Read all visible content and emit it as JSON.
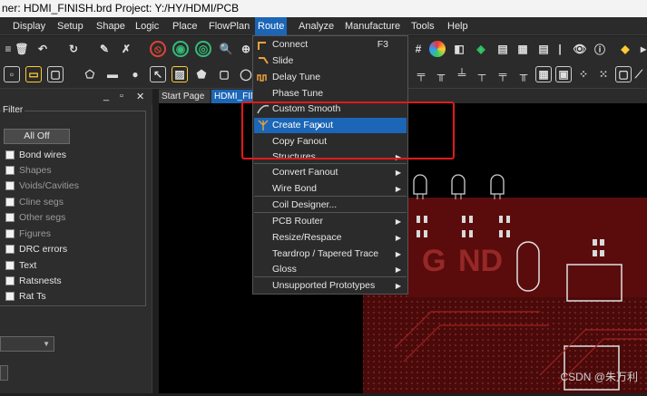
{
  "window": {
    "title": "ner: HDMI_FINISH.brd  Project: Y:/HY/HDMI/PCB"
  },
  "menubar": {
    "items": [
      "Display",
      "Setup",
      "Shape",
      "Logic",
      "Place",
      "FlowPlan",
      "Route",
      "Analyze",
      "Manufacture",
      "Tools",
      "Help"
    ],
    "active": "Route"
  },
  "route_menu": {
    "items": [
      {
        "label": "Connect",
        "shortcut": "F3",
        "submenu": false
      },
      {
        "label": "Slide",
        "submenu": false
      },
      {
        "label": "Delay Tune",
        "submenu": false
      },
      {
        "label": "Phase Tune",
        "submenu": false
      },
      {
        "label": "Custom Smooth",
        "submenu": false
      },
      {
        "label": "Create Fanout",
        "submenu": false,
        "highlighted": true
      },
      {
        "label": "Copy Fanout",
        "submenu": false
      },
      {
        "label": "Structures",
        "submenu": true
      },
      {
        "label": "Convert Fanout",
        "submenu": true
      },
      {
        "label": "Wire Bond",
        "submenu": true
      },
      {
        "label": "Coil Designer...",
        "submenu": false
      },
      {
        "label": "PCB Router",
        "submenu": true
      },
      {
        "label": "Resize/Respace",
        "submenu": true
      },
      {
        "label": "Teardrop / Tapered Trace",
        "submenu": true
      },
      {
        "label": "Gloss",
        "submenu": true
      },
      {
        "label": "Unsupported Prototypes",
        "submenu": true
      }
    ]
  },
  "panel": {
    "window_controls": [
      "_",
      "▫",
      "✕"
    ],
    "filter_title": "Filter",
    "all_button": "All Off",
    "checkboxes": [
      {
        "label": "Bond wires",
        "enabled": true
      },
      {
        "label": "Shapes",
        "enabled": false
      },
      {
        "label": "Voids/Cavities",
        "enabled": false
      },
      {
        "label": "Cline segs",
        "enabled": false
      },
      {
        "label": "Other segs",
        "enabled": false
      },
      {
        "label": "Figures",
        "enabled": false
      },
      {
        "label": "DRC errors",
        "enabled": true
      },
      {
        "label": "Text",
        "enabled": true
      },
      {
        "label": "Ratsnests",
        "enabled": true
      },
      {
        "label": "Rat Ts",
        "enabled": true
      }
    ]
  },
  "tabs": [
    "Start Page",
    "HDMI_FIN"
  ],
  "watermark": "CSDN @朱万利",
  "colors": {
    "accent": "#1c66b7",
    "highlight_box": "#e21a1a",
    "board": "#5a0c0c"
  }
}
